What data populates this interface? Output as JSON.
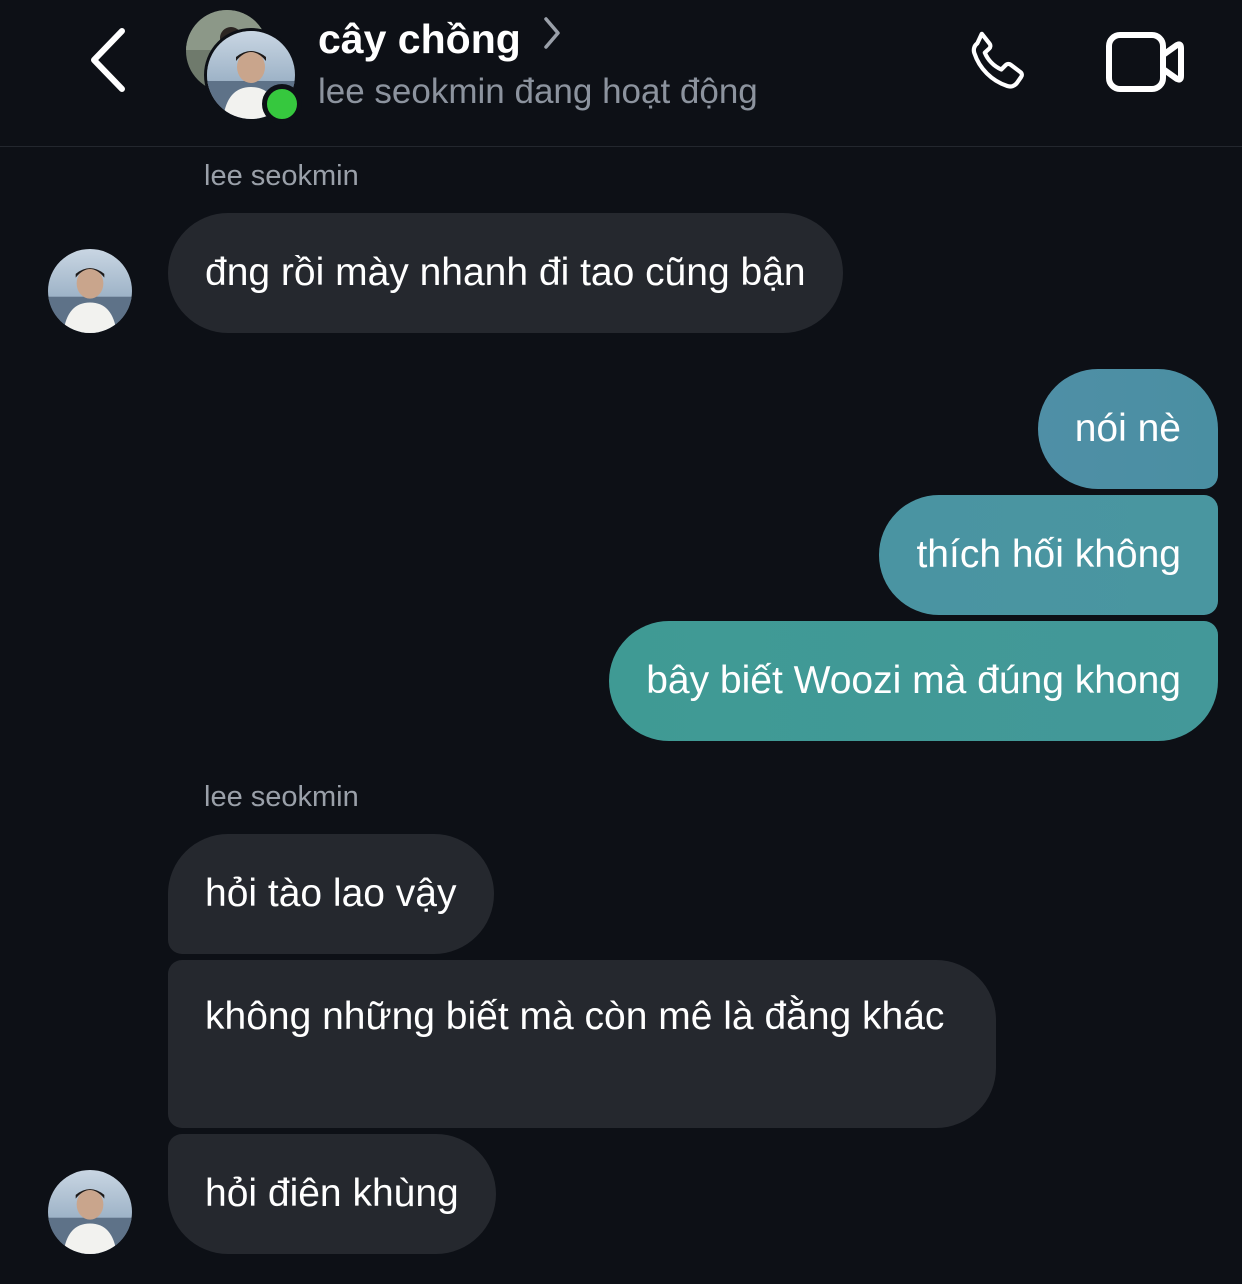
{
  "header": {
    "contact_name": "cây chồng",
    "status": "lee seokmin đang hoạt động",
    "icons": {
      "back": "chevron-left-icon",
      "title_chevron": "chevron-right-icon",
      "call": "phone-icon",
      "video": "video-camera-icon"
    },
    "online_color": "#36c83e"
  },
  "messages": {
    "group1": {
      "sender": "lee seokmin",
      "items": [
        "đng rồi mày nhanh đi tao cũng bận"
      ]
    },
    "outgoing": {
      "items": [
        "nói nè",
        "thích hối không",
        "bây biết Woozi mà đúng khong"
      ]
    },
    "group2": {
      "sender": "lee seokmin",
      "items": [
        "hỏi tào lao vậy",
        "không những biết mà còn mê là đằng khác",
        "hỏi điên khùng"
      ]
    }
  },
  "colors": {
    "background": "#0d1016",
    "incoming_bubble": "#25282e",
    "outgoing_gradient": [
      "#4f8fa6",
      "#3f9a94"
    ]
  }
}
